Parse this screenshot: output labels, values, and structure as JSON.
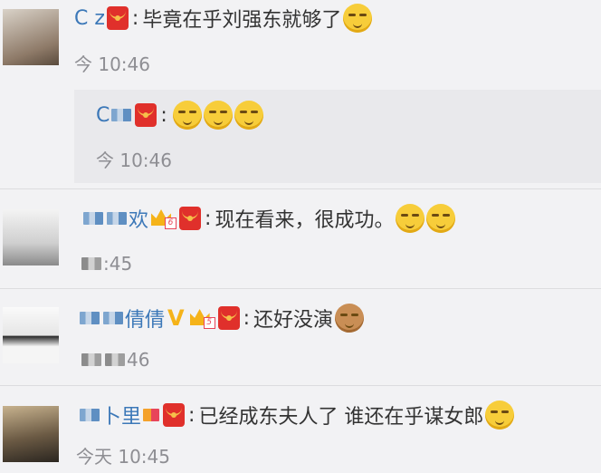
{
  "comments": [
    {
      "username": "C   z",
      "text": "毕竟在乎刘强东就够了",
      "time": "今    10:46",
      "emoji": [
        "doge-emoji"
      ]
    },
    {
      "username": "C   ",
      "text": "",
      "time": "今  10:46",
      "emoji": [
        "doge-emoji",
        "doge-emoji",
        "doge-emoji"
      ]
    },
    {
      "username": "欢",
      "text": "现在看来，很成功。",
      "time": "    :45",
      "emoji": [
        "doge-emoji",
        "doge-emoji"
      ],
      "badge_level": "6"
    },
    {
      "username": "倩倩",
      "text": "还好没演",
      "time": "   46",
      "emoji": [
        "dog-emoji"
      ],
      "badge_level": "5"
    },
    {
      "username": "卜里",
      "text": "已经成东夫人了 谁还在乎谋女郎",
      "time": "今天 10:45",
      "emoji": [
        "doge-emoji"
      ]
    }
  ],
  "colon": ":"
}
